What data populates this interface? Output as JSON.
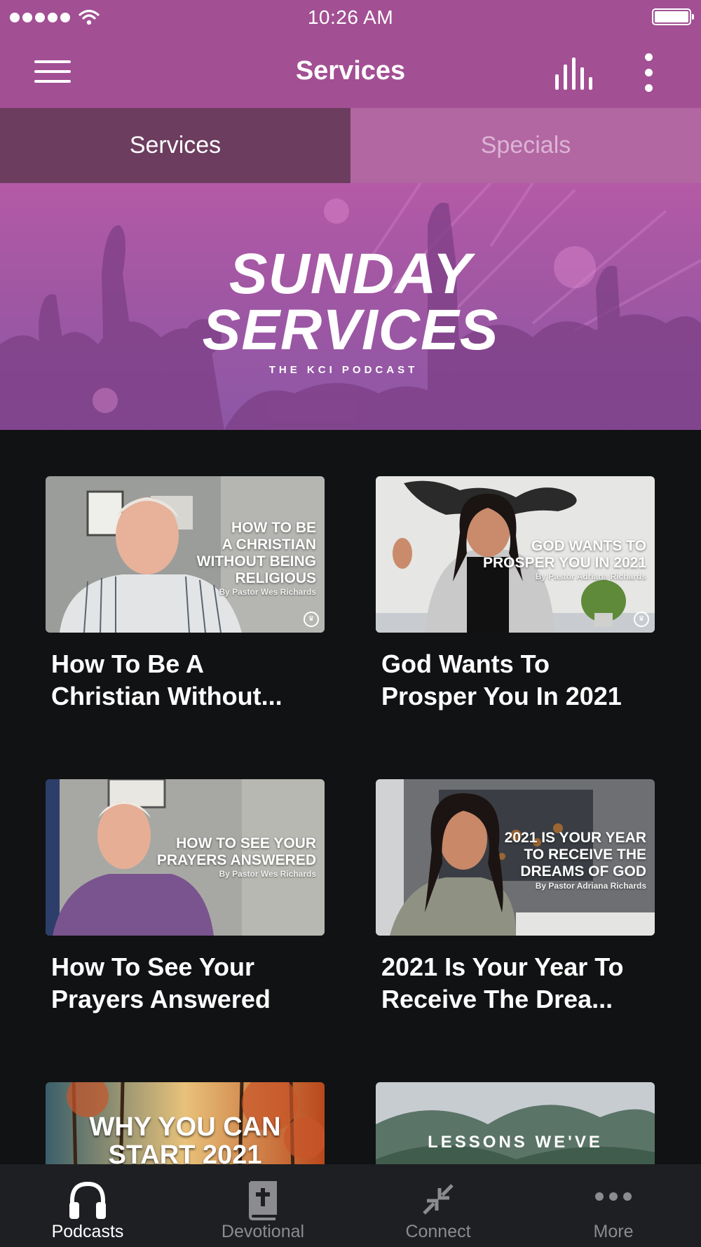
{
  "status_bar": {
    "time": "10:26 AM"
  },
  "header": {
    "title": "Services",
    "icons": [
      "menu-icon",
      "equalizer-icon",
      "more-vertical-icon"
    ]
  },
  "tabs": [
    {
      "label": "Services",
      "active": true
    },
    {
      "label": "Specials",
      "active": false
    }
  ],
  "banner": {
    "title_line1": "SUNDAY",
    "title_line2": "SERVICES",
    "subtitle": "THE KCI PODCAST"
  },
  "episodes": [
    {
      "thumb_title": "HOW TO BE\nA CHRISTIAN\nWITHOUT BEING\nRELIGIOUS",
      "thumb_author": "By Pastor Wes Richards",
      "title": "How To Be A\nChristian Without..."
    },
    {
      "thumb_title": "GOD WANTS TO\nPROSPER YOU IN 2021",
      "thumb_author": "By Pastor Adriana Richards",
      "title": "God Wants To\nProsper You In 2021"
    },
    {
      "thumb_title": "HOW TO SEE YOUR\nPRAYERS ANSWERED",
      "thumb_author": "By Pastor Wes Richards",
      "title": "How To See Your\nPrayers Answered"
    },
    {
      "thumb_title": "2021 IS YOUR YEAR\nTO RECEIVE THE\nDREAMS OF GOD",
      "thumb_author": "By Pastor Adriana Richards",
      "title": "2021 Is Your Year To\nReceive The Drea..."
    },
    {
      "thumb_title": "WHY YOU CAN\nSTART 2021"
    },
    {
      "thumb_title": "LESSONS WE'VE"
    }
  ],
  "bottom_nav": [
    {
      "label": "Podcasts",
      "icon": "headphones-icon",
      "active": true
    },
    {
      "label": "Devotional",
      "icon": "bible-icon",
      "active": false
    },
    {
      "label": "Connect",
      "icon": "connect-icon",
      "active": false
    },
    {
      "label": "More",
      "icon": "more-horizontal-icon",
      "active": false
    }
  ],
  "colors": {
    "primary": "#a24f93",
    "tab_active": "#6c3d5f",
    "tab_inactive": "#b267a3",
    "background": "#111214",
    "bottom_nav": "#1e1f22"
  }
}
